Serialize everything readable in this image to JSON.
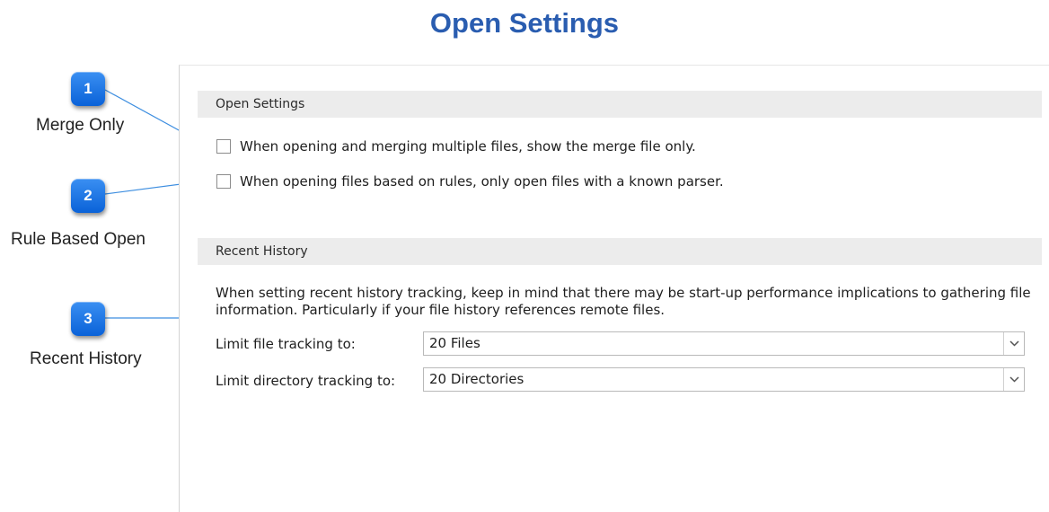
{
  "page": {
    "title": "Open Settings"
  },
  "callouts": [
    {
      "number": "1",
      "label": "Merge Only"
    },
    {
      "number": "2",
      "label": "Rule Based Open"
    },
    {
      "number": "3",
      "label": "Recent History"
    }
  ],
  "open_settings": {
    "header": "Open Settings",
    "options": [
      {
        "label": "When opening and merging multiple files, show the merge file only.",
        "checked": false
      },
      {
        "label": "When opening files based on rules, only open files with a known parser.",
        "checked": false
      }
    ]
  },
  "recent_history": {
    "header": "Recent History",
    "info": "When setting recent history tracking, keep in mind that there may be start-up performance implications to gathering file information.  Particularly if your file history references remote files.",
    "file_tracking": {
      "label": "Limit file tracking to:",
      "value": "20 Files"
    },
    "directory_tracking": {
      "label": "Limit directory tracking to:",
      "value": "20 Directories"
    }
  },
  "colors": {
    "title": "#2a5db0",
    "badge": "#1a73e8",
    "leader_line": "#3d8ee0"
  },
  "icons": {
    "dropdown": "chevron-down-icon",
    "checkbox": "checkbox-unchecked-icon"
  }
}
